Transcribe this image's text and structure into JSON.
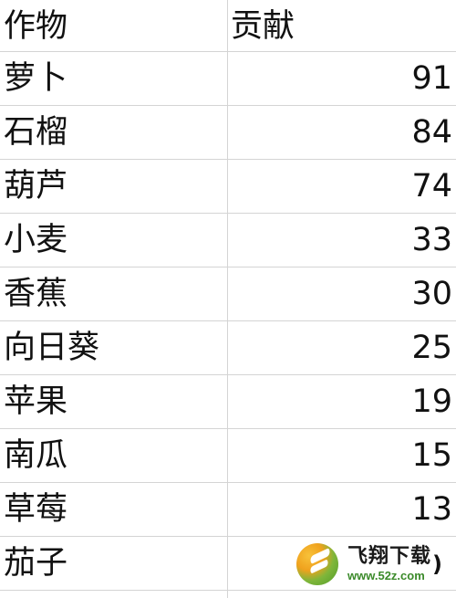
{
  "table": {
    "headers": {
      "crop": "作物",
      "contribution": "贡献"
    },
    "rows": [
      {
        "crop": "萝卜",
        "value": "91"
      },
      {
        "crop": "石榴",
        "value": "84"
      },
      {
        "crop": "葫芦",
        "value": "74"
      },
      {
        "crop": "小麦",
        "value": "33"
      },
      {
        "crop": "香蕉",
        "value": "30"
      },
      {
        "crop": "向日葵",
        "value": "25"
      },
      {
        "crop": "苹果",
        "value": "19"
      },
      {
        "crop": "南瓜",
        "value": "15"
      },
      {
        "crop": "草莓",
        "value": "13"
      },
      {
        "crop": "茄子",
        "value": ""
      }
    ]
  },
  "watermark": {
    "brand": "飞翔下载",
    "url": "www.52z.com",
    "obscured_value_tail": ")"
  },
  "colors": {
    "grid_line": "#d4d4d4",
    "text": "#111111",
    "watermark_green": "#3b8a2a",
    "watermark_orange": "#f0a21e"
  }
}
